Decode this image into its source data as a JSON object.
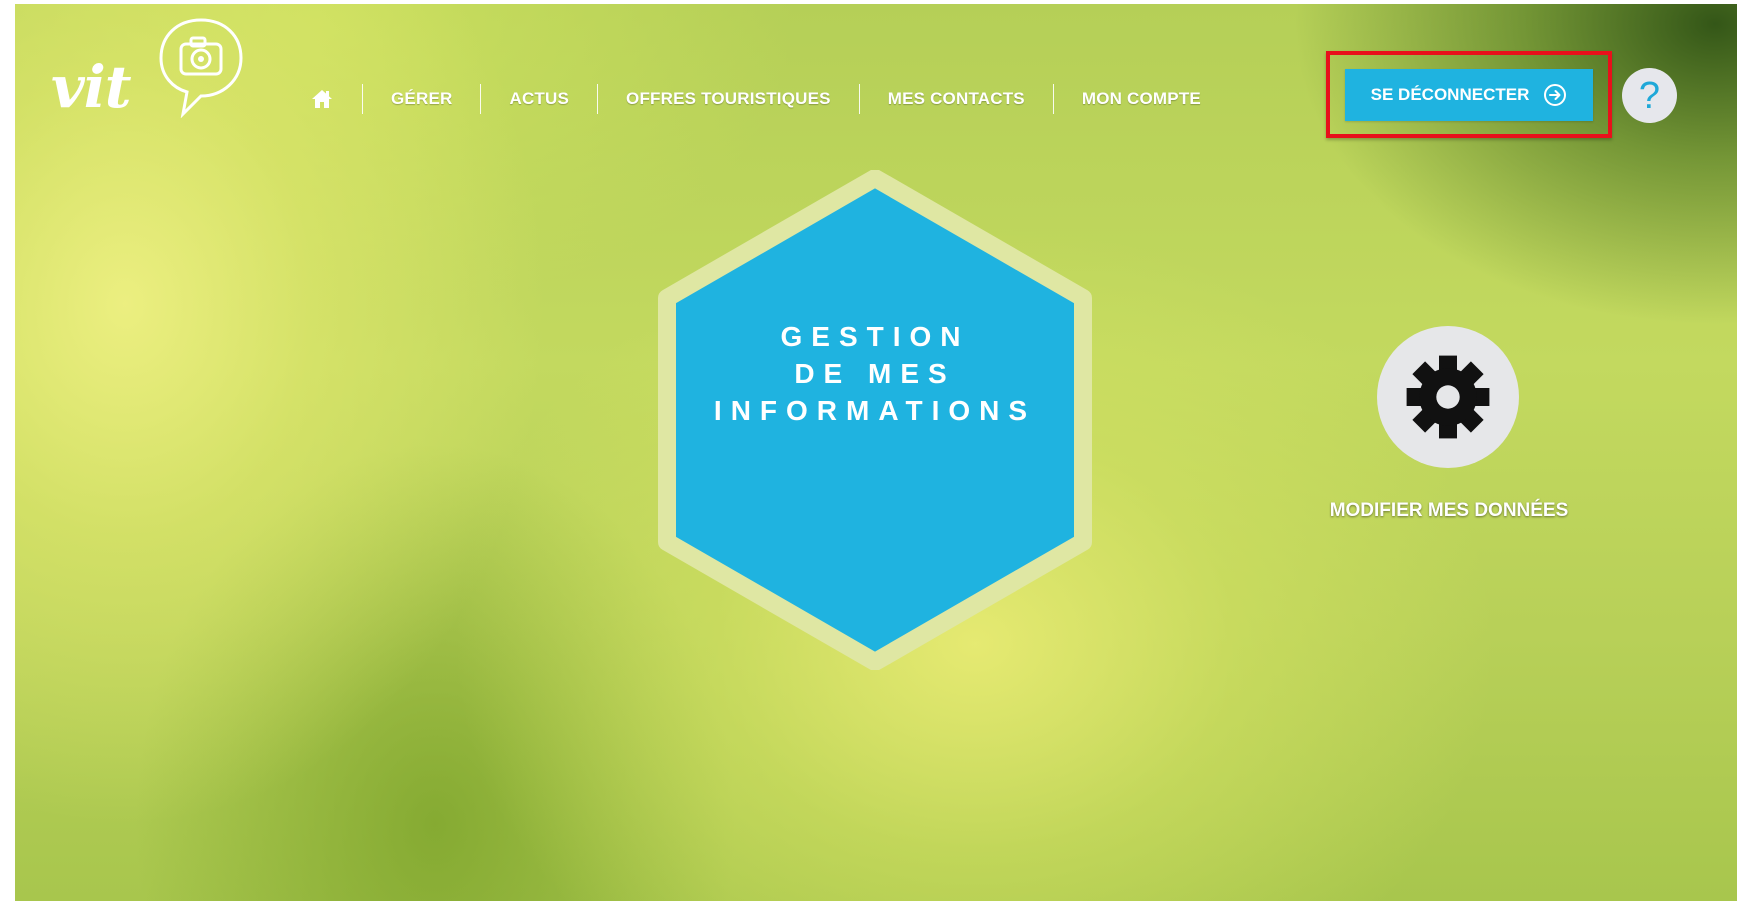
{
  "app": {
    "logo_text": "vit"
  },
  "nav": {
    "home_icon": "home-icon",
    "items": [
      {
        "label": "GÉRER"
      },
      {
        "label": "ACTUS"
      },
      {
        "label": "OFFRES TOURISTIQUES"
      },
      {
        "label": "MES CONTACTS"
      },
      {
        "label": "MON COMPTE"
      }
    ]
  },
  "header": {
    "logout_label": "SE DÉCONNECTER",
    "logout_icon": "arrow-circle-right-icon",
    "help_label": "?"
  },
  "main": {
    "hex_title_lines": [
      "GESTION",
      "DE MES",
      "INFORMATIONS"
    ],
    "tiles": [
      {
        "label": "MODIFIER MES DONNÉES",
        "icon": "gear-icon"
      }
    ]
  },
  "colors": {
    "accent": "#1fb3e0",
    "highlight_outline": "#e8101b",
    "hex_border": "#dfe7a3",
    "tile_circle": "#e6e7e9"
  }
}
